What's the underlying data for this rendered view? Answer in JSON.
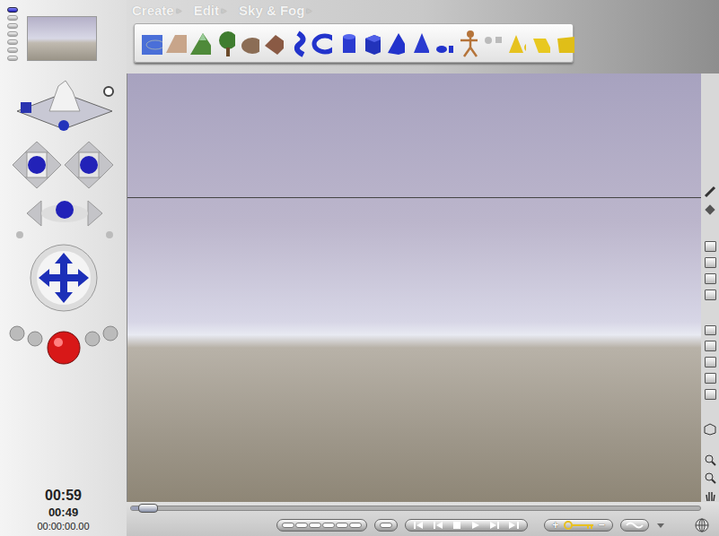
{
  "menu": [
    {
      "label": "Create",
      "arrow": "▸"
    },
    {
      "label": "Edit",
      "arrow": "▸"
    },
    {
      "label": "Sky & Fog",
      "arrow": "▸"
    }
  ],
  "time": {
    "primary": "00:59",
    "secondary": "00:49",
    "timecode": "00:00:00.00"
  },
  "timeline": {
    "level": 0.03
  },
  "keyframe": {
    "add": "+",
    "remove": "−"
  }
}
